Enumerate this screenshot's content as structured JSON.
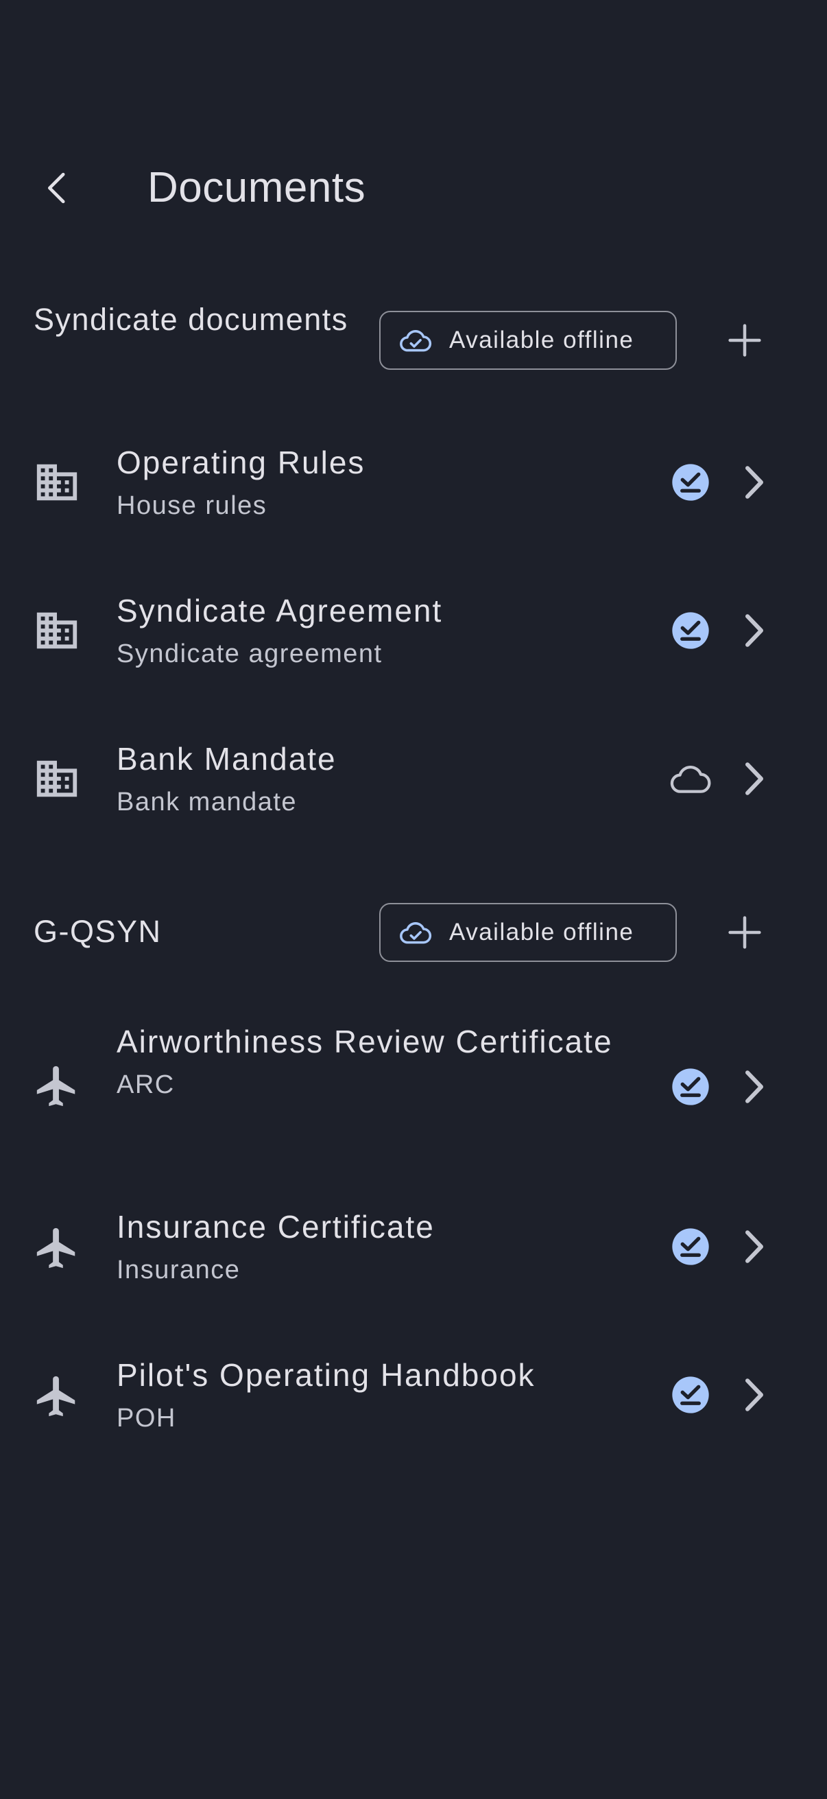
{
  "header": {
    "title": "Documents"
  },
  "sections": [
    {
      "title": "Syndicate documents",
      "offline_label": "Available offline",
      "documents": [
        {
          "name": "Operating Rules",
          "subtitle": "House rules",
          "status": "downloaded"
        },
        {
          "name": "Syndicate Agreement",
          "subtitle": "Syndicate agreement",
          "status": "downloaded"
        },
        {
          "name": "Bank Mandate",
          "subtitle": "Bank mandate",
          "status": "cloud"
        }
      ]
    },
    {
      "title": "G-QSYN",
      "offline_label": "Available offline",
      "documents": [
        {
          "name": "Airworthiness Review Certificate",
          "subtitle": "ARC",
          "status": "downloaded"
        },
        {
          "name": "Insurance Certificate",
          "subtitle": "Insurance",
          "status": "downloaded"
        },
        {
          "name": "Pilot's Operating Handbook",
          "subtitle": "POH",
          "status": "downloaded"
        }
      ]
    }
  ],
  "colors": {
    "background": "#1d202a",
    "text_primary": "#e3e2e8",
    "text_secondary": "#c4c6d0",
    "accent": "#a8c7fa",
    "outline": "#8e9099",
    "icon": "#c4c6d0"
  },
  "icons": {
    "back": "arrow-back-icon",
    "add": "add-icon",
    "offline": "cloud-done-icon",
    "syndicate_doc": "building-icon",
    "aircraft_doc": "airplane-icon",
    "downloaded": "download-done-icon",
    "not_downloaded": "cloud-outline-icon",
    "open": "chevron-right-icon"
  }
}
